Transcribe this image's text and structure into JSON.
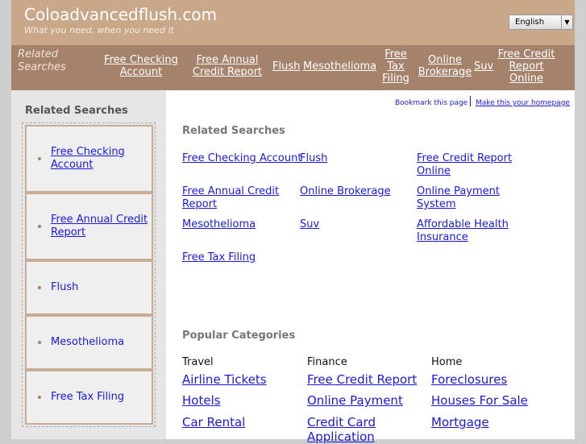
{
  "header": {
    "title": "Coloadvancedflush.com",
    "tagline": "What you need, when you need it",
    "language": "English"
  },
  "nav": {
    "label": "Related Searches",
    "links": [
      "Free Checking Account",
      "Free Annual Credit Report",
      "Flush",
      "Mesothelioma",
      "Free Tax Filing",
      "Online Brokerage",
      "Suv",
      "Free Credit Report Online"
    ]
  },
  "sidebar": {
    "title": "Related Searches",
    "items": [
      "Free Checking Account",
      "Free Annual Credit Report",
      "Flush",
      "Mesothelioma",
      "Free Tax Filing"
    ]
  },
  "top_links": {
    "bookmark": "Bookmark this page",
    "homepage": "Make this your homepage"
  },
  "related": {
    "title": "Related Searches",
    "links": [
      "Free Checking Account",
      "Flush",
      "Free Credit Report Online",
      "Free Annual Credit Report",
      "Online Brokerage",
      "Online Payment System",
      "Mesothelioma",
      "Suv",
      "Affordable Health Insurance",
      "Free Tax Filing"
    ]
  },
  "popular": {
    "title": "Popular Categories",
    "columns": [
      {
        "name": "Travel",
        "links": [
          "Airline Tickets",
          "Hotels",
          "Car Rental"
        ]
      },
      {
        "name": "Finance",
        "links": [
          "Free Credit Report",
          "Online Payment",
          "Credit Card Application"
        ]
      },
      {
        "name": "Home",
        "links": [
          "Foreclosures",
          "Houses For Sale",
          "Mortgage"
        ]
      }
    ]
  }
}
